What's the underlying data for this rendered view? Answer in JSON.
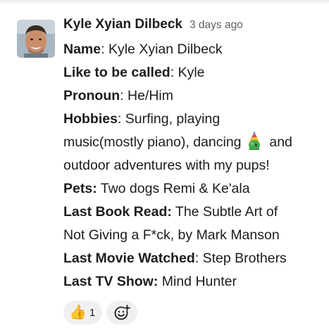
{
  "message": {
    "author": "Kyle Xyian Dilbeck",
    "timestamp": "3 days ago",
    "lines": {
      "l1_label": "Name",
      "l1_sep": ": ",
      "l1_value": "Kyle Xyian Dilbeck",
      "l2_label": "Like to be called",
      "l2_sep": ": ",
      "l2_value": "Kyle",
      "l3_label": "Pronoun",
      "l3_sep": ": ",
      "l3_value": "He/Him",
      "l4_label": "Hobbies",
      "l4_sep": ": ",
      "l4_value": "Surfing, playing",
      "l5_a": "music(mostly piano), dancing ",
      "l5_b": " and",
      "l6": "outdoor adventures with my pups!",
      "l7_label": "Pets:",
      "l7_value": " Two dogs Remi & Ke'ala",
      "l8_label": "Last Book Read:",
      "l8_value": " The Subtle Art of",
      "l9": "Not Giving a F*ck, by Mark Manson",
      "l10_label": "Last Movie Watched",
      "l10_sep": ": ",
      "l10_value": "Step Brothers",
      "l11_label": "Last TV Show:",
      "l11_value": " Mind Hunter"
    },
    "inline_emoji": "party-parrot-icon"
  },
  "reactions": [
    {
      "emoji": "👍",
      "count": "1"
    }
  ],
  "add_reaction_icon": "add-emoji-icon",
  "colors": {
    "text": "#1d1c1d",
    "timestamp": "#616061",
    "pill_bg": "#f0f0f0"
  }
}
